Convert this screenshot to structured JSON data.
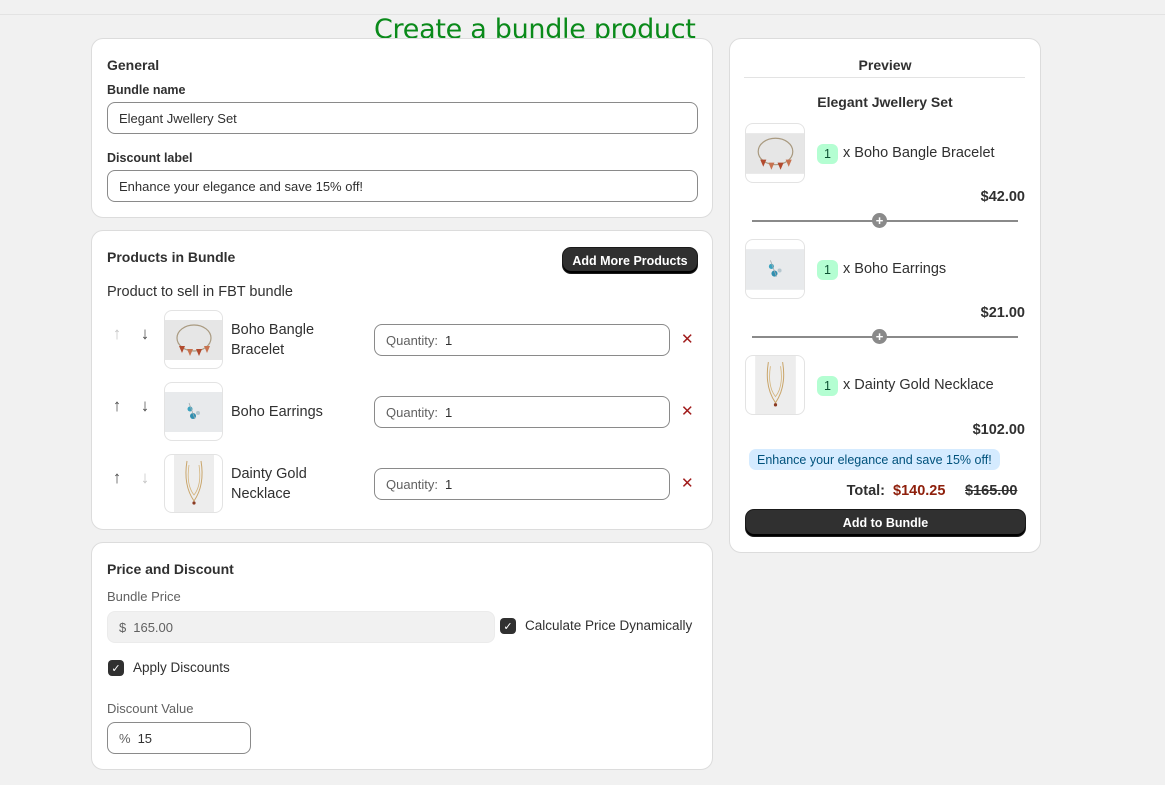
{
  "page": {
    "title": "Create a bundle product"
  },
  "general": {
    "title": "General",
    "bundle_name_label": "Bundle name",
    "bundle_name_value": "Elegant Jwellery Set",
    "discount_label_label": "Discount label",
    "discount_label_value": "Enhance your elegance and save 15% off!"
  },
  "products": {
    "title": "Products in Bundle",
    "add_button": "Add More Products",
    "subtitle": "Product to sell in FBT bundle",
    "quantity_prefix": "Quantity:",
    "items": [
      {
        "name": "Boho Bangle Bracelet",
        "quantity": "1",
        "icon": "bracelet-thumbnail"
      },
      {
        "name": "Boho Earrings",
        "quantity": "1",
        "icon": "earrings-thumbnail"
      },
      {
        "name": "Dainty Gold Necklace",
        "quantity": "1",
        "icon": "necklace-thumbnail"
      }
    ],
    "up_icon": "↑",
    "down_icon": "↓",
    "remove_icon": "✕"
  },
  "pricing": {
    "title": "Price and Discount",
    "bundle_price_label": "Bundle Price",
    "currency_prefix": "$",
    "bundle_price_value": "165.00",
    "calc_dynamic_label": "Calculate Price Dynamically",
    "calc_dynamic_checked": true,
    "apply_discounts_label": "Apply Discounts",
    "apply_discounts_checked": true,
    "discount_value_label": "Discount Value",
    "percent_prefix": "%",
    "discount_value": "15"
  },
  "preview": {
    "title": "Preview",
    "bundle_name": "Elegant Jwellery Set",
    "items": [
      {
        "qty": "1",
        "name": "x Boho Bangle Bracelet",
        "price": "$42.00"
      },
      {
        "qty": "1",
        "name": "x Boho Earrings",
        "price": "$21.00"
      },
      {
        "qty": "1",
        "name": "x Dainty Gold Necklace",
        "price": "$102.00"
      }
    ],
    "discount_badge": "Enhance your elegance and save 15% off!",
    "total_label": "Total:",
    "total_discounted": "$140.25",
    "total_original": "$165.00",
    "add_button": "Add to Bundle"
  },
  "colors": {
    "title_green": "#0a8a1a",
    "discount_red": "#8e1f0b",
    "badge_green": "#b4fed2",
    "badge_blue": "#d5ebff",
    "remove_red": "#a11c1c"
  }
}
